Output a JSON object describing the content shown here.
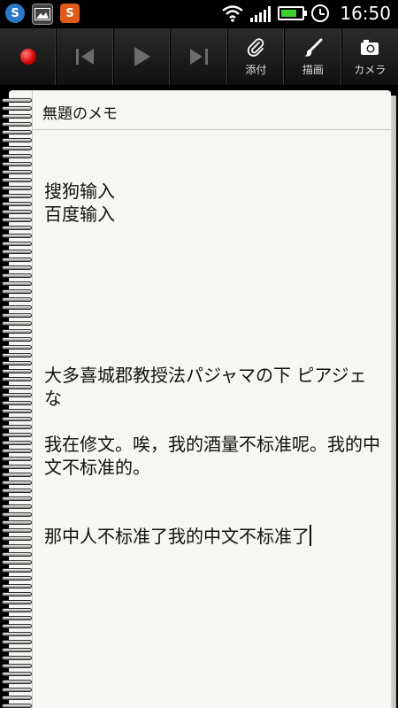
{
  "status_bar": {
    "left_icons": [
      "sogou-app-icon",
      "gallery-icon",
      "sogou-input-icon"
    ],
    "time": "16:50",
    "battery_level": 0.75,
    "colors": {
      "battery": "#3bd12e"
    }
  },
  "toolbar": {
    "attach_label": "添付",
    "draw_label": "描画",
    "camera_label": "カメラ",
    "colors": {
      "record": "#d10000"
    }
  },
  "memo": {
    "title": "無題のメモ",
    "line1": "搜狗输入",
    "line2": "百度输入",
    "line3": "大多喜城郡教授法パジャマの下 ピアジェな",
    "line4": "我在修文。唉，我的酒量不标准呢。我的中文不标准的。",
    "line5": "那中人不标准了我的中文不标准了"
  }
}
